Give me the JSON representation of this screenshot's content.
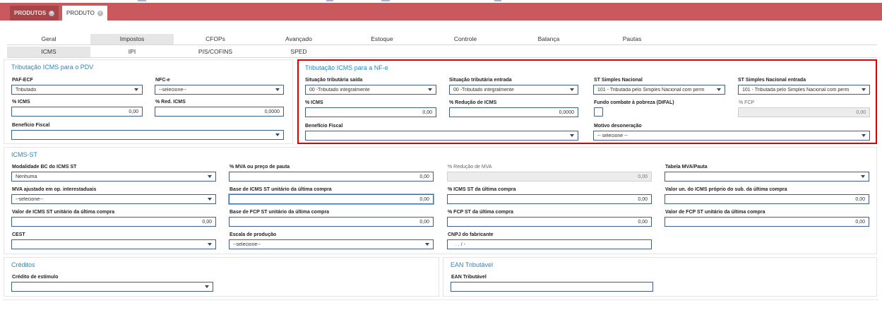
{
  "doc_tabs": [
    {
      "label": "PRODUTOS",
      "active": false
    },
    {
      "label": "PRODUTO",
      "active": true
    }
  ],
  "main_tabs": [
    "Geral",
    "Impostos",
    "CFOPs",
    "Avançado",
    "Estoque",
    "Controle",
    "Balança",
    "Pautas"
  ],
  "active_main_tab": "Impostos",
  "sub_tabs": [
    "ICMS",
    "IPI",
    "PIS/COFINS",
    "SPED"
  ],
  "active_sub_tab": "ICMS",
  "pdv": {
    "title": "Tributação ICMS para o PDV",
    "paf_ecf_label": "PAF-ECF",
    "paf_ecf_value": "Tributado",
    "nfce_label": "NFC-e",
    "nfce_value": "--selecione--",
    "icms_label": "% ICMS",
    "icms_value": "0,00",
    "red_icms_label": "% Red. ICMS",
    "red_icms_value": "0,0000",
    "beneficio_label": "Benefício Fiscal",
    "beneficio_value": ""
  },
  "nfe": {
    "title": "Tributação ICMS para a NF-e",
    "sit_saida_label": "Situação tributária saída",
    "sit_saida_value": "00 -Tributado integralmente",
    "sit_entrada_label": "Situação tributária entrada",
    "sit_entrada_value": "00 -Tributado integralmente",
    "st_simples_label": "ST Simples Nacional",
    "st_simples_value": "101 - Tributada pelo Simples Nacional com perm",
    "st_simples_entrada_label": "ST Simples Nacional entrada",
    "st_simples_entrada_value": "101 - Tributada pelo Simples Nacional com perm",
    "icms_label": "% ICMS",
    "icms_value": "0,00",
    "reducao_label": "% Redução de ICMS",
    "reducao_value": "0,0000",
    "fcp_pobreza_label": "Fundo combate à pobreza (DIFAL)",
    "fcp_label": "% FCP",
    "fcp_value": "0,00",
    "beneficio_label": "Benefício Fiscal",
    "beneficio_value": "",
    "motivo_label": "Motivo desoneração",
    "motivo_value": "-- selecione --"
  },
  "icms_st": {
    "title": "ICMS-ST",
    "modalidade_label": "Modalidade BC do ICMS ST",
    "modalidade_value": "Nenhuma",
    "mva_label": "% MVA ou preço de pauta",
    "mva_value": "0,00",
    "red_mva_label": "% Redução de MVA",
    "red_mva_value": "0,00",
    "tabela_label": "Tabela MVA/Pauta",
    "tabela_value": "",
    "mva_ajustado_label": "MVA ajustado em op. interestaduais",
    "mva_ajustado_value": "--selecione--",
    "base_icms_label": "Base de ICMS ST unitário da última compra",
    "base_icms_value": "0,00",
    "icms_st_ult_label": "% ICMS ST da última compra",
    "icms_st_ult_value": "0,00",
    "valor_un_label": "Valor un. do ICMS próprio do sub. da última compra",
    "valor_un_value": "0,00",
    "valor_icms_label": "Valor de ICMS ST unitário da última compra",
    "valor_icms_value": "0,00",
    "base_fcp_label": "Base de FCP ST unitário da última compra",
    "base_fcp_value": "0,00",
    "fcp_st_label": "% FCP ST da última compra",
    "fcp_st_value": "0,00",
    "valor_fcp_label": "Valor de FCP ST unitário da última compra",
    "valor_fcp_value": "0,00",
    "cest_label": "CEST",
    "cest_value": "",
    "escala_label": "Escala de produção",
    "escala_value": "--selecione--",
    "cnpj_label": "CNPJ do fabricante",
    "cnpj_value": ". . /  -"
  },
  "creditos": {
    "title": "Créditos",
    "credito_label": "Crédito de estímulo",
    "credito_value": ""
  },
  "ean": {
    "title": "EAN Tributável",
    "ean_label": "EAN Tributável",
    "ean_value": ""
  },
  "colors": {
    "tab_bar": "#c9595c",
    "section_title": "#2a86c3",
    "highlight_border": "#e00000",
    "field_border": "#3b5f8e"
  }
}
